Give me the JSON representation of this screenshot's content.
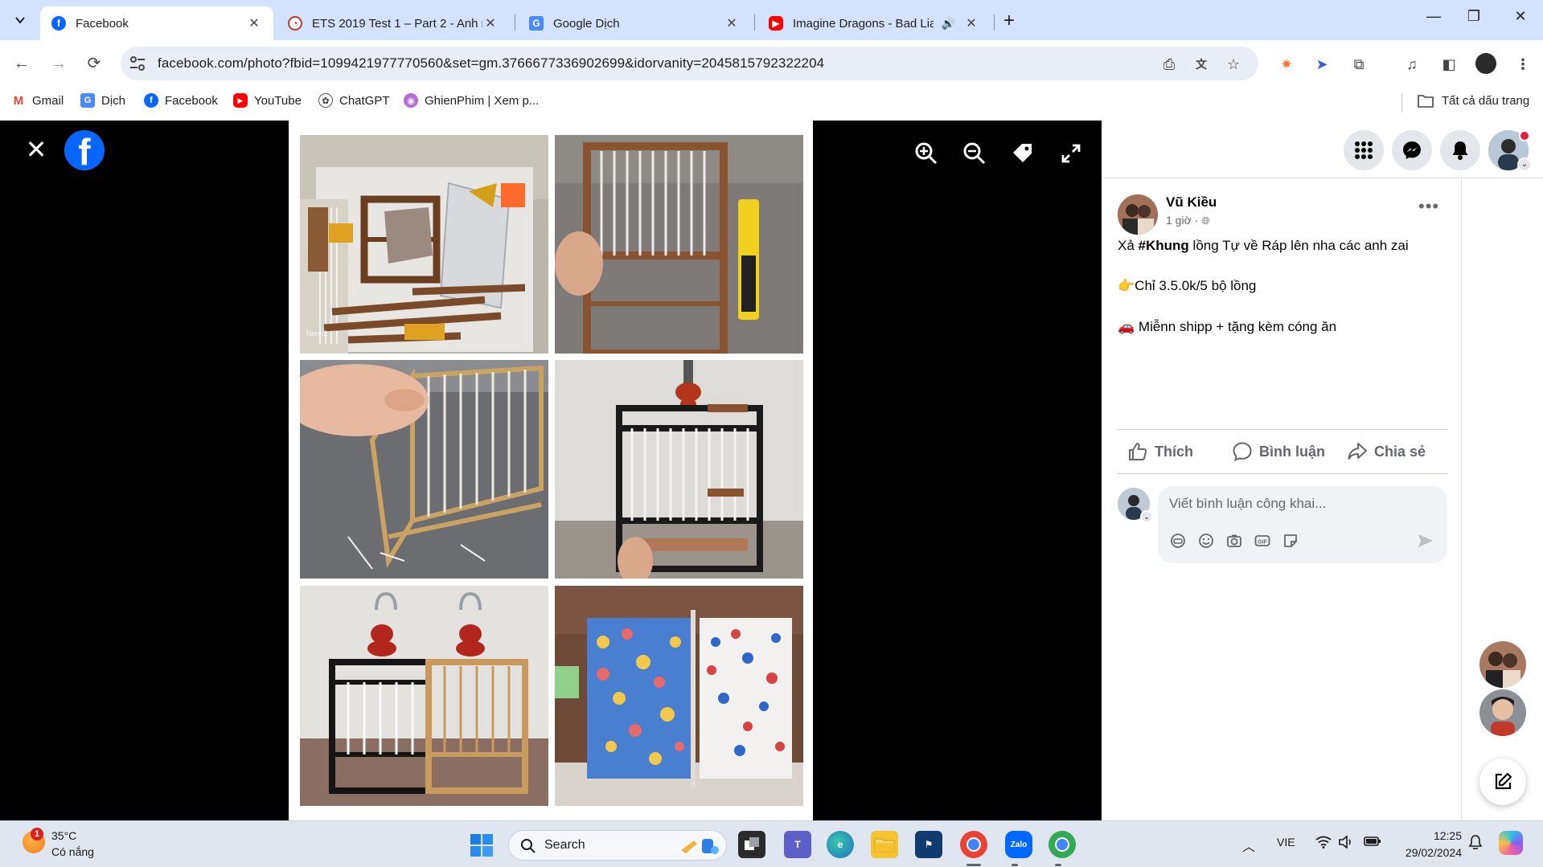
{
  "browser": {
    "tabs": [
      {
        "title": "Facebook",
        "active": true
      },
      {
        "title": "ETS 2019 Test 1 – Part 2 - Anh n",
        "active": false
      },
      {
        "title": "Google Dịch",
        "active": false
      },
      {
        "title": "Imagine Dragons - Bad Liar",
        "active": false
      }
    ],
    "url": "facebook.com/photo?fbid=1099421977770560&set=gm.3766677336902699&idorvanity=2045815792322204",
    "bookmarks": [
      {
        "label": "Gmail",
        "icon": "gmail-icon"
      },
      {
        "label": "Dịch",
        "icon": "translate-icon"
      },
      {
        "label": "Facebook",
        "icon": "facebook-icon"
      },
      {
        "label": "YouTube",
        "icon": "youtube-icon"
      },
      {
        "label": "ChatGPT",
        "icon": "chatgpt-icon"
      },
      {
        "label": "GhienPhim | Xem p...",
        "icon": "ghienphim-icon"
      }
    ],
    "all_bookmarks_label": "Tất cả dấu trang"
  },
  "post": {
    "author": "Vũ Kiều",
    "time": "1 giờ",
    "line1_prefix": "Xả ",
    "line1_hashtag": "#Khung",
    "line1_suffix": " lồng Tự về Ráp lên nha các anh zai",
    "line2_emoji": "👉",
    "line2": "Chỉ 3.5.0k/5 bộ lồng",
    "line3_emoji": "🚗",
    "line3": "Miễnn shipp + tặng kèm cóng ăn"
  },
  "actions": {
    "like": "Thích",
    "comment": "Bình luận",
    "share": "Chia sẻ"
  },
  "comment_box": {
    "placeholder": "Viết bình luận công khai..."
  },
  "photo": {
    "watermark": "Nenn2"
  },
  "taskbar": {
    "weather_badge": "1",
    "temperature": "35°C",
    "weather": "Có nắng",
    "search_label": "Search",
    "language": "VIE",
    "time": "12:25",
    "date": "29/02/2024"
  },
  "colors": {
    "facebook_blue": "#0866ff",
    "tab_strip": "#d3e3fd",
    "viewer_bg": "#000000",
    "notification_red": "#e41e3f"
  }
}
